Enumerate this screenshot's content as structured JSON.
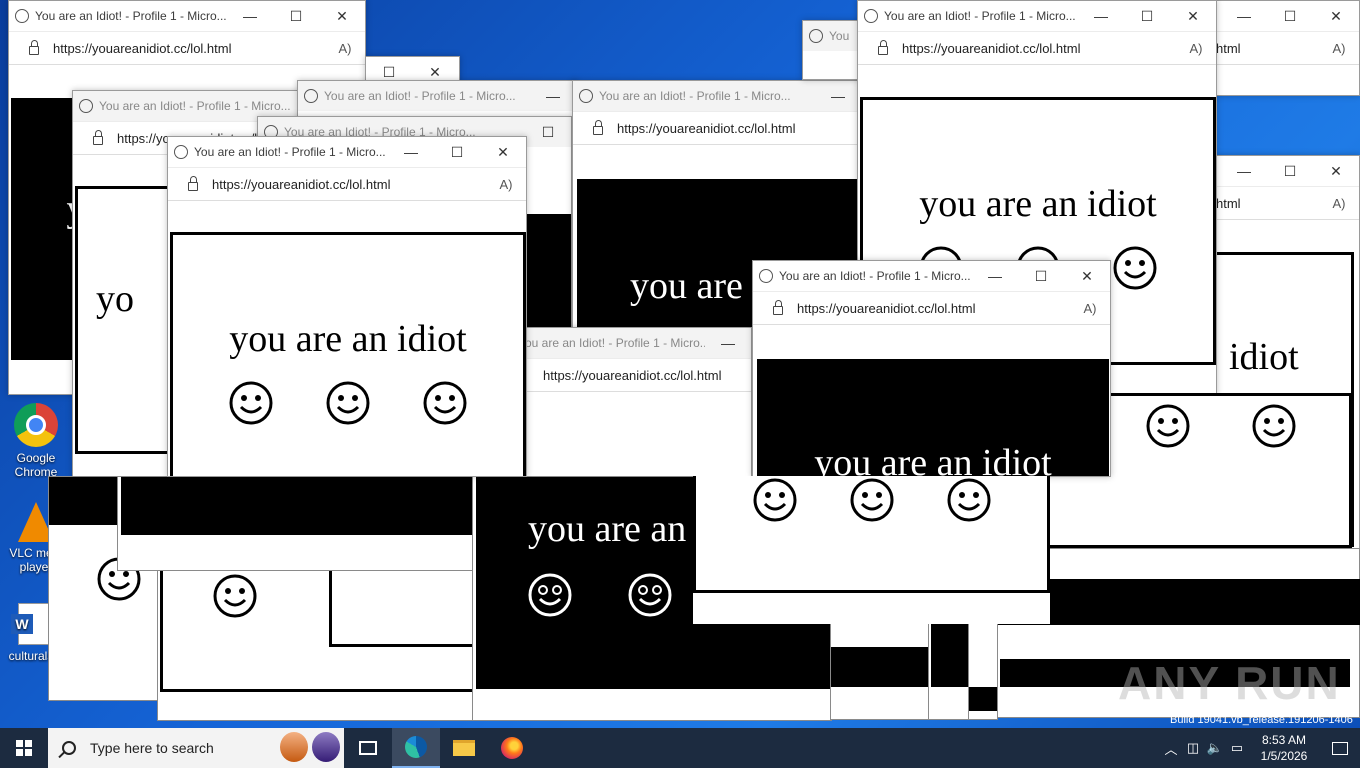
{
  "window": {
    "title": "You are an Idiot! - Profile 1 - Micro...",
    "title_cut_a": "You are an Idiot! - Profile 1 - Micro...",
    "title_cut_b": "ou are an Idiot! - Profile 1 - Micro...",
    "title_cut_c": "You",
    "url": "https://youareanidiot.cc/lol.html",
    "url_cut": "html",
    "url_cut_b": "https://youareanidiot.cc/lol.html",
    "btn_min": "—",
    "btn_max": "☐",
    "btn_close": "✕",
    "read_aloud": "A)",
    "message": "you are an idiot",
    "message_cut_a": "you are an",
    "message_cut_b": "you are",
    "message_cut_c": "idiot",
    "message_cut_d": "y",
    "message_cut_e": "yo"
  },
  "desktop_icons": [
    {
      "label": "Google Chrome",
      "icon": "chrome-icon"
    },
    {
      "label": "VLC me... player",
      "icon": "vlc-icon"
    },
    {
      "label": "culturals...",
      "icon": "word-document-icon"
    }
  ],
  "taskbar": {
    "search_placeholder": "Type here to search",
    "apps": [
      "task-view-icon",
      "edge-icon",
      "file-explorer-icon",
      "firefox-icon"
    ],
    "time": "8:53 AM",
    "date": "1/5/2026"
  },
  "watermark": "ANY RUN",
  "build_text": "Build 19041.vb_release.191206-1406"
}
